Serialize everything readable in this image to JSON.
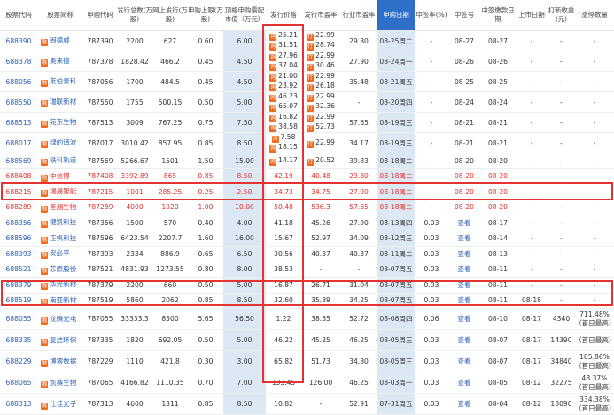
{
  "headers": [
    "股票代码",
    "股票简称",
    "申购代码",
    "发行总数(万股)",
    "网上发行(万股)",
    "申购上限(万股)",
    "顶格申购需配市值（万元）",
    "发行价格",
    "发行市盈率",
    "行业市盈率",
    "申购日期",
    "中签率(%)",
    "中签号",
    "中签缴款日期",
    "上市日期",
    "打新收益(元)",
    "涨停数量"
  ],
  "rows": [
    {
      "code": "688390",
      "name": "固德威",
      "sub": "787390",
      "total": "2200",
      "online": "627",
      "limit": "0.60",
      "mv": "6.00",
      "price": [
        "25.21",
        "31.51"
      ],
      "pe": [
        "22.99",
        "28.74"
      ],
      "ind": "29.80",
      "date": "08-25周二",
      "rate": "-",
      "num": "08-27",
      "pay": "08-27",
      "list": "-",
      "profit": "-",
      "up": "-"
    },
    {
      "code": "688378",
      "name": "奥来德",
      "sub": "787378",
      "total": "1828.42",
      "online": "466.2",
      "limit": "0.45",
      "mv": "4.50",
      "price": [
        "27.96",
        "37.04"
      ],
      "pe": [
        "22.99",
        "30.46"
      ],
      "ind": "27.90",
      "date": "08-24周一",
      "rate": "-",
      "num": "08-26",
      "pay": "08-26",
      "list": "-",
      "profit": "-",
      "up": "-"
    },
    {
      "code": "688056",
      "name": "莱伯泰科",
      "sub": "787056",
      "total": "1700",
      "online": "484.5",
      "limit": "0.45",
      "mv": "4.50",
      "price": [
        "21.00",
        "23.92"
      ],
      "pe": [
        "22.99",
        "26.18"
      ],
      "ind": "35.48",
      "date": "08-21周五",
      "rate": "-",
      "num": "08-25",
      "pay": "08-25",
      "list": "-",
      "profit": "-",
      "up": "-"
    },
    {
      "code": "688550",
      "name": "瑞联新材",
      "sub": "787550",
      "total": "1755",
      "online": "500.15",
      "limit": "0.50",
      "mv": "5.00",
      "price": [
        "46.23",
        "65.07"
      ],
      "pe": [
        "22.99",
        "32.36"
      ],
      "ind": "-",
      "date": "08-20周四",
      "rate": "-",
      "num": "08-24",
      "pay": "08-24",
      "list": "-",
      "profit": "-",
      "up": "-"
    },
    {
      "code": "688513",
      "name": "苑东生物",
      "sub": "787513",
      "total": "3009",
      "online": "767.25",
      "limit": "0.75",
      "mv": "7.50",
      "price": [
        "16.82",
        "38.58"
      ],
      "pe": [
        "22.99",
        "52.73"
      ],
      "ind": "57.65",
      "date": "08-19周三",
      "rate": "-",
      "num": "08-21",
      "pay": "08-21",
      "list": "-",
      "profit": "-",
      "up": "-"
    },
    {
      "code": "688017",
      "name": "绿的谐波",
      "sub": "787017",
      "total": "3010.42",
      "online": "857.95",
      "limit": "0.85",
      "mv": "8.50",
      "price": [
        "7.58",
        "18.15"
      ],
      "pe": [
        "22.99",
        ""
      ],
      "ind": "34.17",
      "date": "08-19周三",
      "rate": "-",
      "num": "08-21",
      "pay": "08-21",
      "list": "-",
      "profit": "-",
      "up": "-"
    },
    {
      "code": "688569",
      "name": "铁科轨道",
      "sub": "787569",
      "total": "5266.67",
      "online": "1501",
      "limit": "1.50",
      "mv": "15.00",
      "price": [
        "14.17",
        ""
      ],
      "pe": [
        "20.52",
        ""
      ],
      "ind": "39.83",
      "date": "08-18周二",
      "rate": "-",
      "num": "08-20",
      "pay": "08-20",
      "list": "-",
      "profit": "-",
      "up": "-"
    },
    {
      "code": "688408",
      "name": "中信博",
      "sub": "787408",
      "total": "3392.89",
      "online": "865",
      "limit": "0.85",
      "mv": "8.50",
      "price": [
        "42.19"
      ],
      "pe": [
        "40.48"
      ],
      "ind": "29.80",
      "date": "08-18周二",
      "rate": "-",
      "num": "08-20",
      "pay": "08-20",
      "list": "-",
      "profit": "-",
      "up": "-",
      "red": true
    },
    {
      "code": "688215",
      "name": "瑞晟智能",
      "sub": "787215",
      "total": "1001",
      "online": "285.25",
      "limit": "0.25",
      "mv": "2.50",
      "price": [
        "34.73"
      ],
      "pe": [
        "34.75"
      ],
      "ind": "27.90",
      "date": "08-18周二",
      "rate": "-",
      "num": "08-20",
      "pay": "08-20",
      "list": "-",
      "profit": "-",
      "up": "-",
      "red": true
    },
    {
      "code": "688289",
      "name": "圣湘生物",
      "sub": "787289",
      "total": "4000",
      "online": "1020",
      "limit": "1.00",
      "mv": "10.00",
      "price": [
        "50.48"
      ],
      "pe": [
        "536.3"
      ],
      "ind": "57.65",
      "date": "08-18周二",
      "rate": "-",
      "num": "08-20",
      "pay": "08-20",
      "list": "-",
      "profit": "-",
      "up": "-",
      "red": true
    },
    {
      "code": "688356",
      "name": "键凯科技",
      "sub": "787356",
      "total": "1500",
      "online": "570",
      "limit": "0.40",
      "mv": "4.00",
      "price": [
        "41.18"
      ],
      "pe": [
        "45.26"
      ],
      "ind": "27.90",
      "date": "08-13周四",
      "rate": "0.03",
      "num": "查看",
      "pay": "08-17",
      "list": "-",
      "profit": "-",
      "up": "-"
    },
    {
      "code": "688596",
      "name": "正帆科技",
      "sub": "787596",
      "total": "6423.54",
      "online": "2207.7",
      "limit": "1.60",
      "mv": "16.00",
      "price": [
        "15.67"
      ],
      "pe": [
        "52.97"
      ],
      "ind": "34.09",
      "date": "08-12周三",
      "rate": "0.03",
      "num": "查看",
      "pay": "08-14",
      "list": "-",
      "profit": "-",
      "up": "-"
    },
    {
      "code": "688393",
      "name": "安必平",
      "sub": "787393",
      "total": "2334",
      "online": "886.9",
      "limit": "0.65",
      "mv": "6.50",
      "price": [
        "30.56"
      ],
      "pe": [
        "40.37"
      ],
      "ind": "40.37",
      "date": "08-11周二",
      "rate": "0.03",
      "num": "查看",
      "pay": "08-13",
      "list": "-",
      "profit": "-",
      "up": "-"
    },
    {
      "code": "688521",
      "name": "芯原股份",
      "sub": "787521",
      "total": "4831.93",
      "online": "1273.55",
      "limit": "0.80",
      "mv": "8.00",
      "price": [
        "38.53"
      ],
      "pe": [
        "-"
      ],
      "ind": "-",
      "date": "08-07周五",
      "rate": "0.03",
      "num": "查看",
      "pay": "08-11",
      "list": "-",
      "profit": "-",
      "up": "-"
    },
    {
      "code": "688379",
      "name": "华光新材",
      "sub": "787379",
      "total": "2200",
      "online": "660",
      "limit": "0.50",
      "mv": "5.00",
      "price": [
        "16.87"
      ],
      "pe": [
        "26.71"
      ],
      "ind": "31.04",
      "date": "08-07周五",
      "rate": "0.03",
      "num": "查看",
      "pay": "08-11",
      "list": "-",
      "profit": "-",
      "up": "-"
    },
    {
      "code": "688519",
      "name": "南亚新材",
      "sub": "787519",
      "total": "5860",
      "online": "2062",
      "limit": "0.85",
      "mv": "8.50",
      "price": [
        "32.60"
      ],
      "pe": [
        "35.89"
      ],
      "ind": "34.25",
      "date": "08-07周五",
      "rate": "0.03",
      "num": "查看",
      "pay": "08-11",
      "list": "08-18",
      "profit": "-",
      "up": "-"
    },
    {
      "code": "688055",
      "name": "龙腾光电",
      "sub": "787055",
      "total": "33333.3",
      "online": "8500",
      "limit": "5.65",
      "mv": "56.50",
      "price": [
        "1.22"
      ],
      "pe": [
        "38.35"
      ],
      "ind": "52.72",
      "date": "08-06周四",
      "rate": "0.06",
      "num": "查看",
      "pay": "08-10",
      "list": "08-17",
      "profit": "4340",
      "up": [
        "711.48%",
        "（首日最高）"
      ],
      "tall": true
    },
    {
      "code": "688335",
      "name": "复洁环保",
      "sub": "787335",
      "total": "1820",
      "online": "692.05",
      "limit": "0.50",
      "mv": "5.00",
      "price": [
        "46.22"
      ],
      "pe": [
        "45.25"
      ],
      "ind": "46.25",
      "date": "08-05周三",
      "rate": "0.03",
      "num": "查看",
      "pay": "08-07",
      "list": "08-17",
      "profit": "14390",
      "up": [
        "",
        "（首日最高）"
      ],
      "tall": true
    },
    {
      "code": "688229",
      "name": "博睿数据",
      "sub": "787229",
      "total": "1110",
      "online": "421.8",
      "limit": "0.30",
      "mv": "3.00",
      "price": [
        "65.82"
      ],
      "pe": [
        "51.73"
      ],
      "ind": "34.80",
      "date": "08-05周三",
      "rate": "0.03",
      "num": "查看",
      "pay": "08-07",
      "list": "08-17",
      "profit": "34840",
      "up": [
        "105.86%",
        "（首日最高）"
      ],
      "tall": true
    },
    {
      "code": "688065",
      "name": "凯赛生物",
      "sub": "787065",
      "total": "4166.82",
      "online": "1110.35",
      "limit": "0.70",
      "mv": "7.00",
      "price": [
        "133.45"
      ],
      "pe": [
        "126.00"
      ],
      "ind": "46.25",
      "date": "08-03周一",
      "rate": "0.03",
      "num": "查看",
      "pay": "08-05",
      "list": "08-12",
      "profit": "32275",
      "up": [
        "48.37%",
        "（首日最高）"
      ],
      "tall": true
    },
    {
      "code": "688313",
      "name": "仕佳光子",
      "sub": "787313",
      "total": "4600",
      "online": "1311",
      "limit": "0.85",
      "mv": "8.50",
      "price": [
        "10.82"
      ],
      "pe": [
        "-"
      ],
      "ind": "52.91",
      "date": "07-31周五",
      "rate": "0.03",
      "num": "查看",
      "pay": "08-04",
      "list": "08-12",
      "profit": "18090",
      "up": [
        "334.38%",
        "（首日最高）"
      ],
      "tall": true
    }
  ]
}
